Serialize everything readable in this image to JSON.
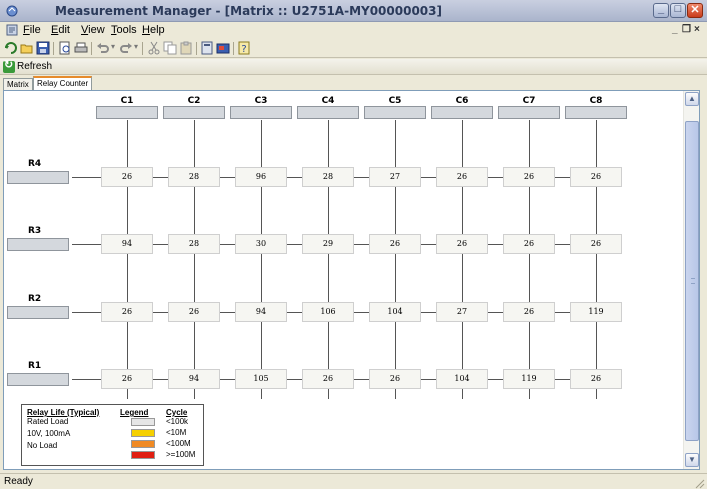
{
  "window": {
    "title": "Measurement Manager - [Matrix :: U2751A-MY00000003]",
    "minimize": "_",
    "maximize": "□",
    "close": "✕"
  },
  "menu": [
    "File",
    "Edit",
    "View",
    "Tools",
    "Help"
  ],
  "mdi_controls": {
    "minimize": "_",
    "restore": "❐",
    "close": "×"
  },
  "toolbar_icons": [
    "connect-icon",
    "open-icon",
    "save-icon",
    "print-preview-icon",
    "print-icon",
    "undo-icon",
    "redo-icon",
    "cut-icon",
    "copy-icon",
    "paste-icon",
    "calculator-icon",
    "instrument-icon",
    "help-icon"
  ],
  "refresh": {
    "label": "Refresh"
  },
  "tabs": [
    {
      "label": "Matrix",
      "active": false
    },
    {
      "label": "Relay Counter",
      "active": true
    }
  ],
  "matrix": {
    "columns": [
      "C1",
      "C2",
      "C3",
      "C4",
      "C5",
      "C6",
      "C7",
      "C8"
    ],
    "rows": [
      {
        "label": "R4",
        "counts": [
          "26",
          "28",
          "96",
          "28",
          "27",
          "26",
          "26",
          "26"
        ]
      },
      {
        "label": "R3",
        "counts": [
          "94",
          "28",
          "30",
          "29",
          "26",
          "26",
          "26",
          "26"
        ]
      },
      {
        "label": "R2",
        "counts": [
          "26",
          "26",
          "94",
          "106",
          "104",
          "27",
          "26",
          "119"
        ]
      },
      {
        "label": "R1",
        "counts": [
          "26",
          "94",
          "105",
          "26",
          "26",
          "104",
          "119",
          "26"
        ]
      }
    ]
  },
  "legend": {
    "headers": {
      "relay_life": "Relay Life (Typical)",
      "legend": "Legend",
      "cycle": "Cycle"
    },
    "conditions": [
      "Rated Load",
      "10V, 100mA",
      "No Load"
    ],
    "items": [
      {
        "color": "#e6e6e6",
        "cycle": "<100k"
      },
      {
        "color": "#f5d000",
        "cycle": "<10M"
      },
      {
        "color": "#f08a24",
        "cycle": "<100M"
      },
      {
        "color": "#e01e12",
        "cycle": ">=100M"
      }
    ]
  },
  "status": {
    "text": "Ready"
  }
}
